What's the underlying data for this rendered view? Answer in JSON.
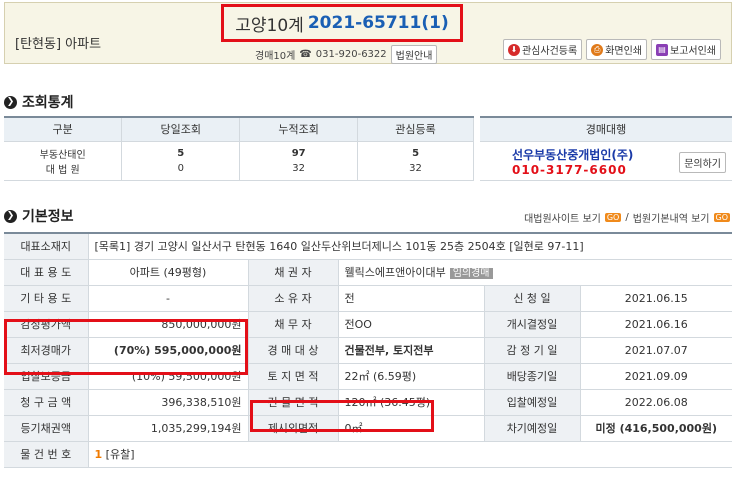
{
  "header": {
    "property_location": "[탄현동] 아파트",
    "court": "고양10계",
    "case_number": "2021-65711(1)",
    "department": "경매10계",
    "phone_icon": "phone-icon",
    "phone": "031-920-6322",
    "court_info_label": "법원안내",
    "buttons": {
      "watch_case": "관심사건등록",
      "print_screen": "화면인쇄",
      "print_report": "보고서인쇄"
    }
  },
  "stats": {
    "title": "조회통계",
    "headers": [
      "구분",
      "당일조회",
      "누적조회",
      "관심등록"
    ],
    "rows": [
      {
        "label": "부동산태인",
        "today": "5",
        "total": "97",
        "watch": "5"
      },
      {
        "label": "대 법 원",
        "today": "0",
        "total": "32",
        "watch": "32"
      }
    ]
  },
  "agent": {
    "header": "경매대행",
    "name": "선우부동산중개법인(주)",
    "phone": "010-3177-6600",
    "inquiry_label": "문의하기"
  },
  "basic": {
    "title": "기본정보",
    "link_court_site": "대법원사이트 보기",
    "link_court_detail": "법원기본내역 보기",
    "go_label": "GO",
    "address_label": "대표소재지",
    "address_value": "[목록1] 경기 고양시 일산서구 탄현동 1640 일산두산위브더제니스 101동 25층 2504호 [일현로 97-11]",
    "use_label": "대 표 용 도",
    "use_value": "아파트 (49평형)",
    "creditor_label": "채 권 자",
    "creditor_value": "웰릭스에프앤아이대부",
    "creditor_tag": "임의경매",
    "other_use_label": "기 타 용 도",
    "other_use_value": "-",
    "owner_label": "소 유 자",
    "owner_value": "전",
    "filed_label": "신 청 일",
    "filed_value": "2021.06.15",
    "appraisal_label": "감정평가액",
    "appraisal_value": "850,000,000원",
    "debtor_label": "채 무 자",
    "debtor_value": "전OO",
    "start_label": "개시결정일",
    "start_value": "2021.06.16",
    "min_price_label": "최저경매가",
    "min_price_value": "(70%) 595,000,000원",
    "target_label": "경 매 대 상",
    "target_value": "건물전부, 토지전부",
    "appraisal_date_label": "감 정 기 일",
    "appraisal_date_value": "2021.07.07",
    "deposit_label": "입찰보증금",
    "deposit_value": "(10%) 59,500,000원",
    "land_area_label": "토 지 면 적",
    "land_area_value": "22㎡ (6.59평)",
    "dividend_label": "배당종기일",
    "dividend_value": "2021.09.09",
    "claim_label": "청 구 금 액",
    "claim_value": "396,338,510원",
    "building_area_label": "건 물 면 적",
    "building_area_value": "120㎡ (36.45평)",
    "bid_date_label": "입찰예정일",
    "bid_date_value": "2022.06.08",
    "registry_label": "등기채권액",
    "registry_value": "1,035,299,194원",
    "excluded_area_label": "제시외면적",
    "excluded_area_value": "0㎡",
    "next_date_label": "차기예정일",
    "next_date_value": "미정 (416,500,000원)",
    "item_no_label": "물 건 번 호",
    "item_no_value": "1",
    "item_status": "[유찰]"
  },
  "colors": {
    "highlight_box": "#e30f18",
    "case_number": "#1a5fb4",
    "agent_name": "#1a3aa8",
    "agent_phone": "#e30f18"
  }
}
